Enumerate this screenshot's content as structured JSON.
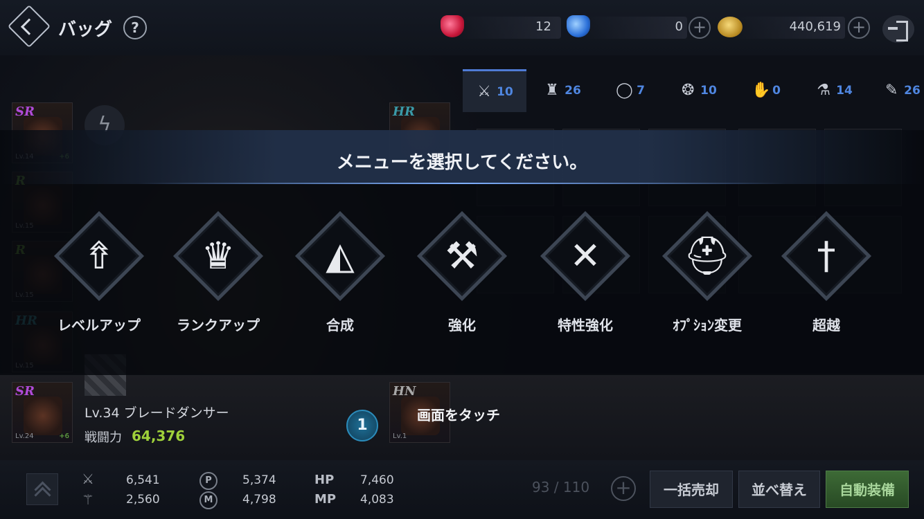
{
  "header": {
    "title": "バッグ",
    "help": "?",
    "currencies": [
      {
        "name": "ruby",
        "value": "12"
      },
      {
        "name": "sapphire",
        "value": "0"
      },
      {
        "name": "gold",
        "value": "440,619"
      }
    ],
    "plus": "+"
  },
  "tabs": [
    {
      "icon": "weapon-icon",
      "glyph": "⚔",
      "count": "10"
    },
    {
      "icon": "armor-icon",
      "glyph": "♜",
      "count": "26"
    },
    {
      "icon": "ring-icon",
      "glyph": "◯",
      "count": "7"
    },
    {
      "icon": "amulet-icon",
      "glyph": "❂",
      "count": "10"
    },
    {
      "icon": "glove-icon",
      "glyph": "✋",
      "count": "0"
    },
    {
      "icon": "potion-icon",
      "glyph": "⚗",
      "count": "14"
    },
    {
      "icon": "scroll-icon",
      "glyph": "✎",
      "count": "26"
    }
  ],
  "equipped": [
    {
      "rank": "SR",
      "rank_color": "#b04bd8",
      "lv": "Lv.14",
      "plus": "+6"
    },
    {
      "rank": "R",
      "rank_color": "#6aa83a",
      "lv": "Lv.15",
      "plus": ""
    },
    {
      "rank": "R",
      "rank_color": "#6aa83a",
      "lv": "Lv.15",
      "plus": ""
    },
    {
      "rank": "HR",
      "rank_color": "#3a9aa8",
      "lv": "Lv.15",
      "plus": ""
    },
    {
      "rank": "SR",
      "rank_color": "#b04bd8",
      "lv": "Lv.24",
      "plus": "+6"
    }
  ],
  "equipped_right": [
    {
      "rank": "HR",
      "rank_color": "#3a9aa8",
      "lv": "",
      "plus": ""
    },
    {
      "rank": "HN",
      "rank_color": "#a8a8a8",
      "lv": "Lv.1",
      "plus": ""
    }
  ],
  "character": {
    "level_class": "Lv.34  ブレードダンサー",
    "power_label": "戦闘力",
    "power_value": "64,376"
  },
  "menu": {
    "prompt": "メニューを選択してください。",
    "items": [
      {
        "label": "レベルアップ",
        "glyph": "⇮"
      },
      {
        "label": "ランクアップ",
        "glyph": "♛"
      },
      {
        "label": "合成",
        "glyph": "◭"
      },
      {
        "label": "強化",
        "glyph": "⚒"
      },
      {
        "label": "特性強化",
        "glyph": "✕"
      },
      {
        "label": "ｵﾌﾟｼｮﾝ変更",
        "glyph": "⛑"
      },
      {
        "label": "超越",
        "glyph": "†"
      }
    ]
  },
  "touch": {
    "badge": "1",
    "text": "画面をタッチ"
  },
  "stats": {
    "atk1": "6,541",
    "atk2": "2,560",
    "p_val": "5,374",
    "m_val": "4,798",
    "hp_label": "HP",
    "hp_val": "7,460",
    "mp_label": "MP",
    "mp_val": "4,083",
    "p_icon": "P",
    "m_icon": "M"
  },
  "bag": {
    "capacity": "93 / 110",
    "sell_all": "一括売却",
    "sort": "並べ替え",
    "auto_equip": "自動装備"
  },
  "colors": {
    "accent": "#4f86e0",
    "power": "#9fd13a",
    "green_button": "#3d6a36"
  }
}
